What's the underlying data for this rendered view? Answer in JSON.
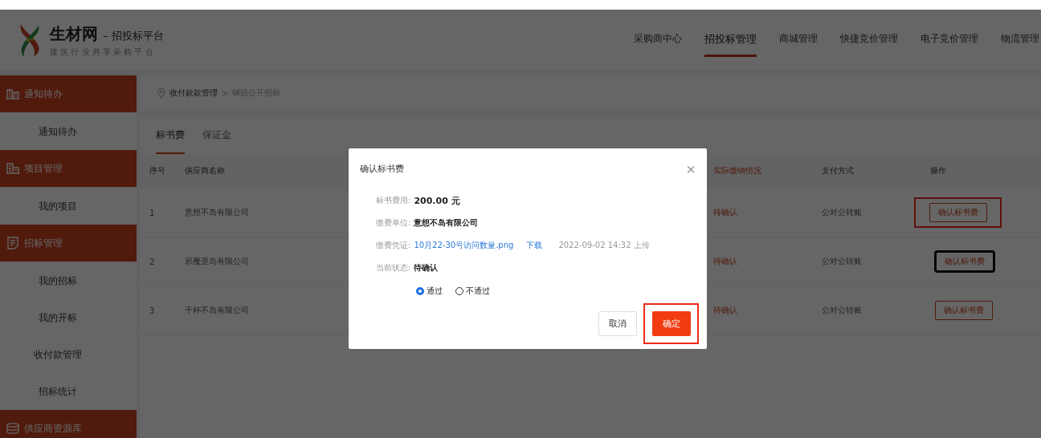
{
  "brand": {
    "name": "生材网",
    "suffix": "– 招投标平台",
    "slogan": "建 筑 行 业 共 享 采 购 平 台"
  },
  "nav": [
    {
      "label": "采购商中心",
      "selected": false
    },
    {
      "label": "招投标管理",
      "selected": true
    },
    {
      "label": "商城管理",
      "selected": false
    },
    {
      "label": "快捷竞价管理",
      "selected": false
    },
    {
      "label": "电子竞价管理",
      "selected": false
    },
    {
      "label": "物流管理",
      "selected": false
    }
  ],
  "sidebar": [
    {
      "title": "通知待办",
      "kind": "notice",
      "items": [
        {
          "label": "通知待办",
          "selected": false
        }
      ]
    },
    {
      "title": "项目管理",
      "kind": "project",
      "items": [
        {
          "label": "我的项目",
          "selected": false
        }
      ]
    },
    {
      "title": "招标管理",
      "kind": "bid",
      "items": [
        {
          "label": "我的招标",
          "selected": false
        },
        {
          "label": "我的开标",
          "selected": false
        },
        {
          "label": "收付款管理",
          "selected": false
        },
        {
          "label": "招标统计",
          "selected": false
        }
      ]
    },
    {
      "title": "供应商资源库",
      "kind": "supplier"
    }
  ],
  "breadcrumb": {
    "parent": "收付款款管理",
    "separator": ">",
    "current": "钢筋公开招标"
  },
  "tabs": [
    {
      "label": "标书费",
      "selected": true
    },
    {
      "label": "保证金",
      "selected": false
    }
  ],
  "table": {
    "columns": [
      {
        "label": "序号",
        "kind": "index"
      },
      {
        "label": "供应商名称",
        "kind": "name"
      },
      {
        "label": "实际缴纳情况",
        "kind": "status"
      },
      {
        "label": "支付方式",
        "kind": "payment"
      },
      {
        "label": "操作",
        "kind": "action"
      }
    ],
    "rows": [
      {
        "index": "1",
        "name": "意想不岛有限公司",
        "status": "待确认",
        "payment": "公对公转账",
        "action": "确认标书费",
        "focused": false,
        "annotated": true
      },
      {
        "index": "2",
        "name": "邪魔歪岛有限公司",
        "status": "待确认",
        "payment": "公对公转账",
        "action": "确认标书费",
        "focused": true,
        "annotated": false
      },
      {
        "index": "3",
        "name": "千杯不岛有限公司",
        "status": "待确认",
        "payment": "公对公转账",
        "action": "确认标书费",
        "focused": false,
        "annotated": false
      }
    ]
  },
  "dialog": {
    "title": "确认标书费",
    "close": "×",
    "fields": [
      {
        "label": "标书费用:",
        "kind": "text",
        "value": "200.00 元"
      },
      {
        "label": "缴费单位:",
        "kind": "text",
        "value": "意想不岛有限公司"
      },
      {
        "label": "缴费凭证:",
        "kind": "file",
        "value": "10月22-30号访问数量.png",
        "link": "下载",
        "note": "2022-09-02 14:32 上传"
      },
      {
        "label": "当前状态:",
        "kind": "text",
        "value": "待确认"
      }
    ],
    "options": [
      {
        "label": "通过",
        "selected": true
      },
      {
        "label": "不通过",
        "selected": false
      }
    ],
    "cancel": "取消",
    "confirm": {
      "label": "确定",
      "annotated": true
    }
  }
}
